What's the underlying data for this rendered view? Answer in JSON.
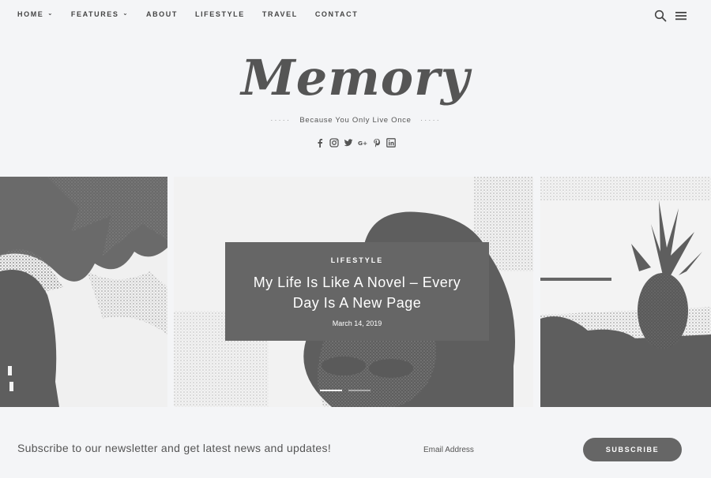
{
  "nav": {
    "items": [
      {
        "label": "HOME",
        "has_dropdown": true
      },
      {
        "label": "FEATURES",
        "has_dropdown": true
      },
      {
        "label": "ABOUT",
        "has_dropdown": false
      },
      {
        "label": "LIFESTYLE",
        "has_dropdown": false
      },
      {
        "label": "TRAVEL",
        "has_dropdown": false
      },
      {
        "label": "CONTACT",
        "has_dropdown": false
      }
    ],
    "chevron": "⌄",
    "icons": [
      "search-icon",
      "hamburger-menu-icon"
    ]
  },
  "header": {
    "logo_text": "Memory",
    "tagline": "Because You Only Live Once",
    "tagline_dots": "·····",
    "socials": [
      "facebook-icon",
      "instagram-icon",
      "twitter-icon",
      "google-plus-icon",
      "pinterest-icon",
      "linkedin-icon"
    ]
  },
  "slider": {
    "featured": {
      "category": "LIFESTYLE",
      "title": "My Life Is Like A Novel – Every Day Is A New Page",
      "date": "March 14, 2019"
    },
    "dots": 2,
    "active_dot": 0
  },
  "newsletter": {
    "text": "Subscribe to our newsletter and get latest news and updates!",
    "email_placeholder": "Email Address",
    "button_label": "SUBSCRIBE"
  },
  "colors": {
    "background": "#f4f5f7",
    "accent": "#666666",
    "text": "#555555"
  }
}
